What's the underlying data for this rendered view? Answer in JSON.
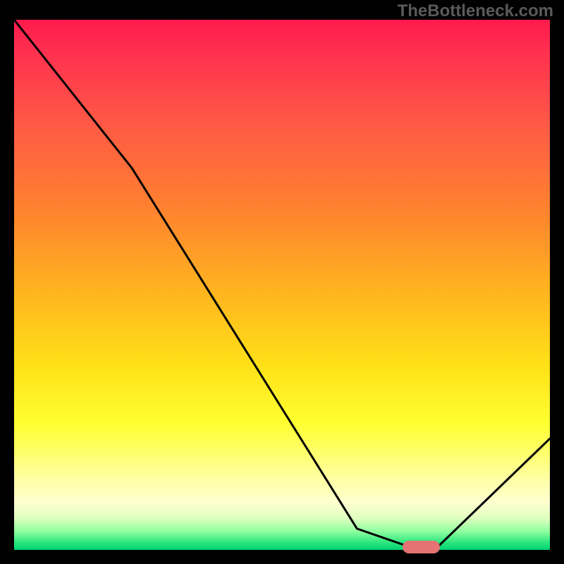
{
  "watermark": "TheBottleneck.com",
  "chart_data": {
    "type": "line",
    "title": "",
    "xlabel": "",
    "ylabel": "",
    "xlim": [
      0,
      100
    ],
    "ylim": [
      0,
      100
    ],
    "grid": false,
    "series": [
      {
        "name": "curve",
        "x": [
          0,
          22,
          64,
          74,
          79,
          100
        ],
        "values": [
          100,
          72,
          4,
          0.5,
          0.5,
          21
        ]
      }
    ],
    "marker": {
      "x_center": 76,
      "y": 0.5,
      "width_pct": 7
    },
    "background": "vertical-gradient red→orange→yellow→green"
  }
}
